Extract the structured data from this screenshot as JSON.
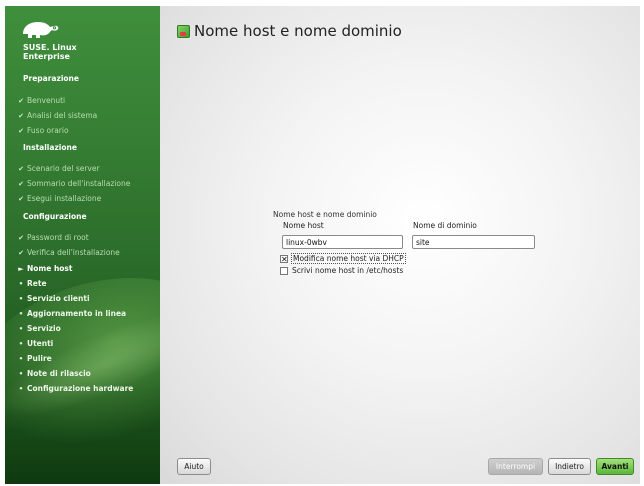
{
  "sidebar": {
    "brand_line1": "SUSE. Linux",
    "brand_line2": "Enterprise",
    "sections": [
      {
        "title": "Preparazione"
      },
      {
        "title": "Installazione"
      },
      {
        "title": "Configurazione"
      }
    ],
    "steps": [
      {
        "label": "Benvenuti",
        "state": "done"
      },
      {
        "label": "Analisi del sistema",
        "state": "done"
      },
      {
        "label": "Fuso orario",
        "state": "done"
      },
      {
        "label": "Scenario del server",
        "state": "done"
      },
      {
        "label": "Sommario dell'installazione",
        "state": "done"
      },
      {
        "label": "Esegui installazione",
        "state": "done"
      },
      {
        "label": "Password di root",
        "state": "done"
      },
      {
        "label": "Verifica dell'installazione",
        "state": "done"
      },
      {
        "label": "Nome host",
        "state": "current"
      },
      {
        "label": "Rete",
        "state": "todo"
      },
      {
        "label": "Servizio clienti",
        "state": "todo"
      },
      {
        "label": "Aggiornamento in linea",
        "state": "todo"
      },
      {
        "label": "Servizio",
        "state": "todo"
      },
      {
        "label": "Utenti",
        "state": "todo"
      },
      {
        "label": "Pulire",
        "state": "todo"
      },
      {
        "label": "Note di rilascio",
        "state": "todo"
      },
      {
        "label": "Configurazione hardware",
        "state": "todo"
      }
    ]
  },
  "main": {
    "title": "Nome host e nome dominio",
    "group_label": "Nome host e nome dominio",
    "hostname_label": "Nome host",
    "hostname_value": "linux-0wbv",
    "domain_label": "Nome di dominio",
    "domain_value": "site",
    "dhcp_checkbox": {
      "label": "Modifica nome host via DHCP",
      "checked": true
    },
    "hosts_checkbox": {
      "label": "Scrivi nome host in /etc/hosts",
      "checked": false
    }
  },
  "buttons": {
    "help": "Aiuto",
    "abort": "Interrompi",
    "back": "Indietro",
    "next": "Avanti"
  },
  "colors": {
    "sidebar_green": "#357d33",
    "accent_green": "#5cb53b"
  }
}
